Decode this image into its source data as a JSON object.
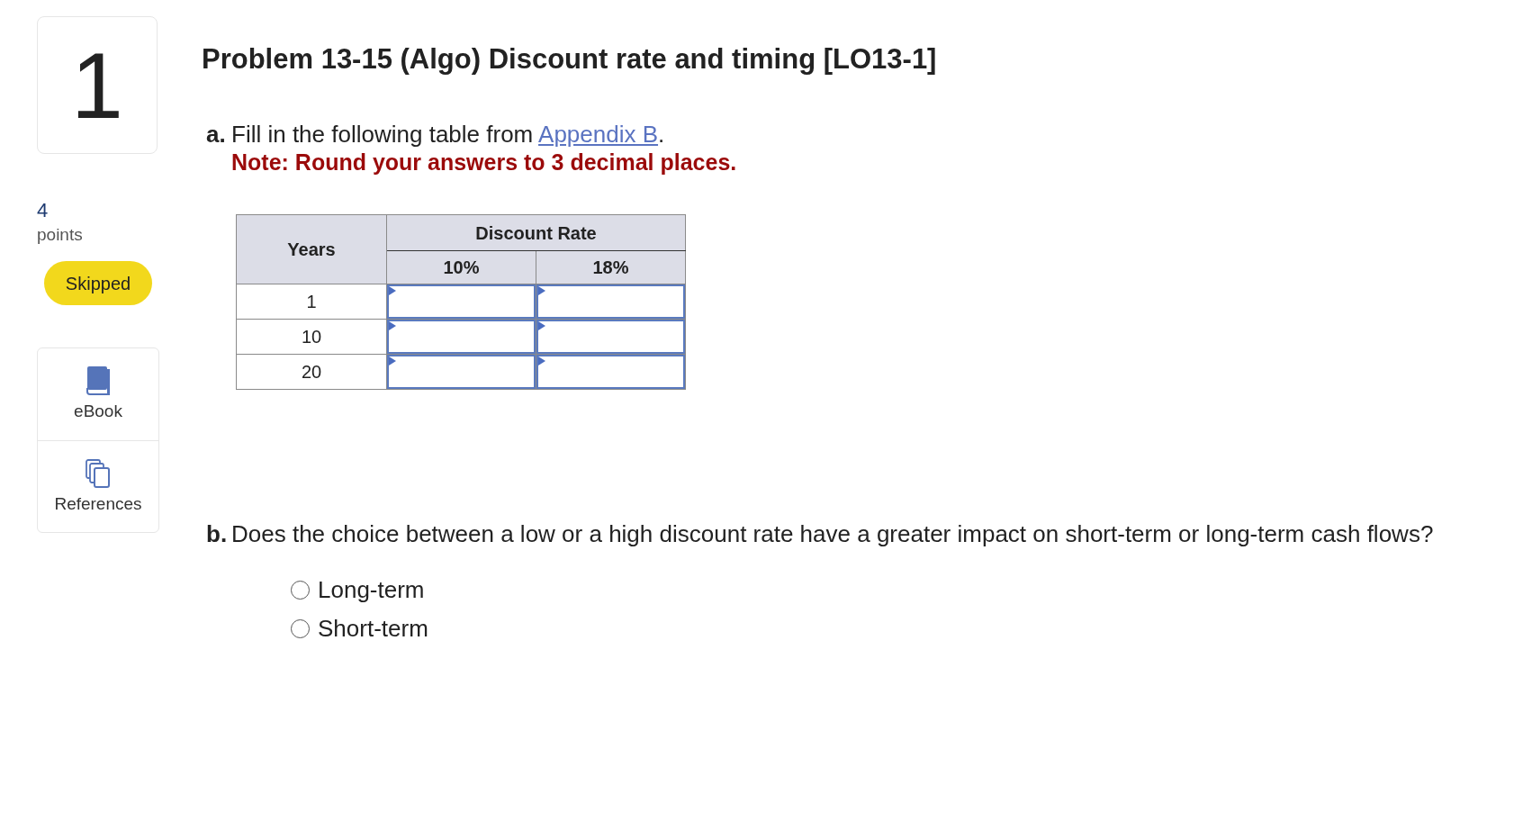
{
  "question": {
    "number": "1",
    "points": "4",
    "points_label": "points",
    "status": "Skipped"
  },
  "tools": [
    {
      "kind": "ebook",
      "label": "eBook"
    },
    {
      "kind": "references",
      "label": "References"
    }
  ],
  "title": "Problem 13-15 (Algo) Discount rate and timing [LO13-1]",
  "part_a": {
    "marker": "a.",
    "text": "Fill in the following table from",
    "link": "Appendix B",
    "text_after": ".",
    "note": "Note: Round your answers to 3 decimal places."
  },
  "table": {
    "columns": {
      "row_header": "Years",
      "group_header": "Discount Rate",
      "rates": [
        "10%",
        "18%"
      ]
    },
    "rows": [
      {
        "year": "1"
      },
      {
        "year": "10"
      },
      {
        "year": "20"
      }
    ]
  },
  "part_b": {
    "marker": "b.",
    "question": "Does the choice between a low or a high discount rate have a greater impact on short-term or long-term cash flows?",
    "options": [
      {
        "label": "Long-term",
        "selected": false
      },
      {
        "label": "Short-term",
        "selected": false
      }
    ]
  }
}
